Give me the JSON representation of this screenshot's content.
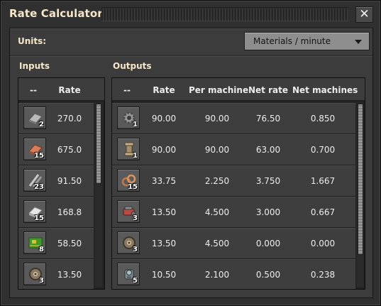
{
  "window": {
    "title": "Rate Calculator",
    "close_glyph": "✕"
  },
  "units": {
    "label": "Units:",
    "selected": "Materials / minute"
  },
  "inputs": {
    "title": "Inputs",
    "columns": [
      "--",
      "Rate"
    ],
    "rows": [
      {
        "icon": "iron-plate-icon",
        "count": "2",
        "rate": "270.0"
      },
      {
        "icon": "copper-plate-icon",
        "count": "15",
        "rate": "675.0"
      },
      {
        "icon": "iron-stick-icon",
        "count": "23",
        "rate": "91.50"
      },
      {
        "icon": "steel-plate-icon",
        "count": "15",
        "rate": "168.8"
      },
      {
        "icon": "electronic-circuit-icon",
        "count": "8",
        "rate": "58.50"
      },
      {
        "icon": "iron-gear-icon",
        "count": "3",
        "rate": "13.50"
      }
    ]
  },
  "outputs": {
    "title": "Outputs",
    "columns": [
      "--",
      "Rate",
      "Per machine",
      "Net rate",
      "Net machines"
    ],
    "rows": [
      {
        "icon": "iron-gear-wheel-icon",
        "count": "1",
        "rate": "90.00",
        "per_machine": "90.00",
        "net_rate": "76.50",
        "net_machines": "0.850"
      },
      {
        "icon": "pipe-icon",
        "count": "1",
        "rate": "90.00",
        "per_machine": "90.00",
        "net_rate": "63.00",
        "net_machines": "0.700"
      },
      {
        "icon": "copper-cable-icon",
        "count": "15",
        "rate": "33.75",
        "per_machine": "2.250",
        "net_rate": "3.750",
        "net_machines": "1.667"
      },
      {
        "icon": "engine-unit-icon",
        "count": "3",
        "rate": "13.50",
        "per_machine": "4.500",
        "net_rate": "3.000",
        "net_machines": "0.667"
      },
      {
        "icon": "iron-gear-icon",
        "count": "3",
        "rate": "13.50",
        "per_machine": "4.500",
        "net_rate": "0.000",
        "net_machines": "0.000"
      },
      {
        "icon": "pump-icon",
        "count": "5",
        "rate": "10.50",
        "per_machine": "2.100",
        "net_rate": "0.500",
        "net_machines": "0.238"
      }
    ]
  },
  "colors": {
    "heading": "#f5e7c8",
    "panel": "#313031",
    "row": "#3e3e3e",
    "dropdown": "#8e8e8e"
  }
}
